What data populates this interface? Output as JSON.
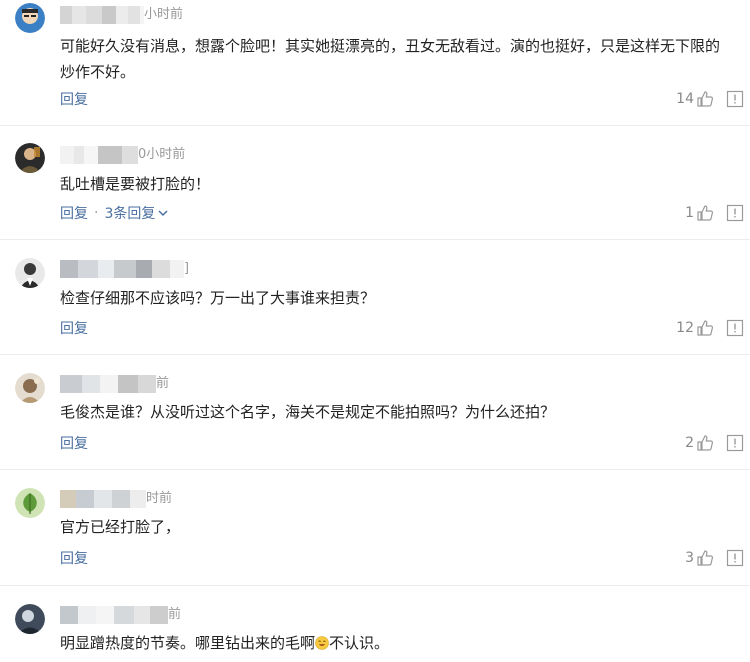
{
  "labels": {
    "reply": "回复"
  },
  "comments": [
    {
      "time": "小时前",
      "text": "可能好久没有消息，想露个脸吧！其实她挺漂亮的，丑女无敌看过。演的也挺好，只是这样无下限的炒作不好。",
      "likes": "14",
      "reply_count": ""
    },
    {
      "time": "0小时前",
      "text": "乱吐槽是要被打脸的！",
      "likes": "1",
      "reply_count": "3条回复"
    },
    {
      "time": "]",
      "text": "检查仔细那不应该吗？万一出了大事谁来担责？",
      "likes": "12",
      "reply_count": ""
    },
    {
      "time": "前",
      "text": "毛俊杰是谁？从没听过这个名字，海关不是规定不能拍照吗？为什么还拍？",
      "likes": "2",
      "reply_count": ""
    },
    {
      "time": "时前",
      "text": "官方已经打脸了，",
      "likes": "3",
      "reply_count": ""
    },
    {
      "time": "前",
      "text_before_emoji": "明显蹭热度的节奏。哪里钻出来的毛啊",
      "text_after_emoji": "不认识。",
      "emoji": "smile-emoji"
    }
  ],
  "icons": {
    "like": "thumbs-up-icon",
    "report": "report-icon",
    "expand": "chevron-down-icon"
  },
  "colors": {
    "link": "#4a6fa0",
    "meta": "#9a9a9a",
    "divider": "#ececec"
  }
}
